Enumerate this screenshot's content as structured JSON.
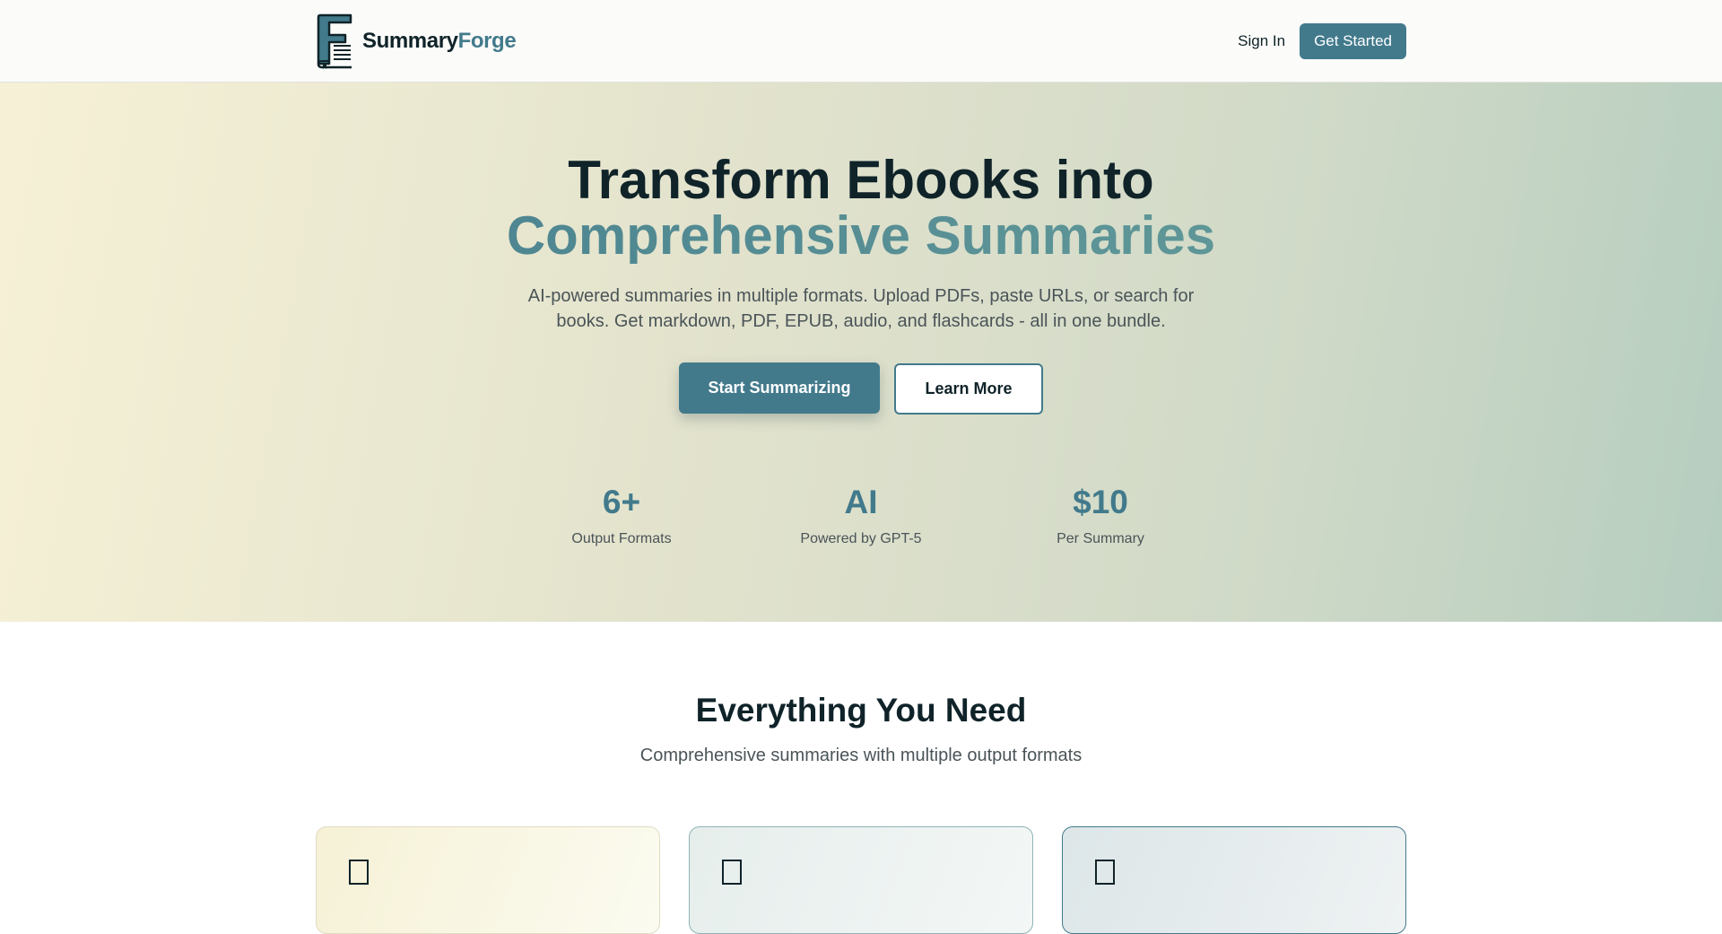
{
  "header": {
    "logo_text_primary": "Summary",
    "logo_text_accent": "Forge",
    "nav_signin": "Sign In",
    "nav_get_started": "Get Started"
  },
  "hero": {
    "title_line1": "Transform Ebooks into",
    "title_line2": "Comprehensive Summaries",
    "subtitle": "AI-powered summaries in multiple formats. Upload PDFs, paste URLs, or search for books. Get markdown, PDF, EPUB, audio, and flashcards - all in one bundle.",
    "cta_primary": "Start Summarizing",
    "cta_secondary": "Learn More"
  },
  "stats": [
    {
      "value": "6+",
      "label": "Output Formats"
    },
    {
      "value": "AI",
      "label": "Powered by GPT-5"
    },
    {
      "value": "$10",
      "label": "Per Summary"
    }
  ],
  "features": {
    "title": "Everything You Need",
    "subtitle": "Comprehensive summaries with multiple output formats"
  },
  "colors": {
    "accent": "#427a8c",
    "dark_text": "#0f2329",
    "muted_text": "#4a5458"
  },
  "icons": {
    "logo": "book-f-logo-icon",
    "card_placeholder": "missing-glyph-icon"
  }
}
